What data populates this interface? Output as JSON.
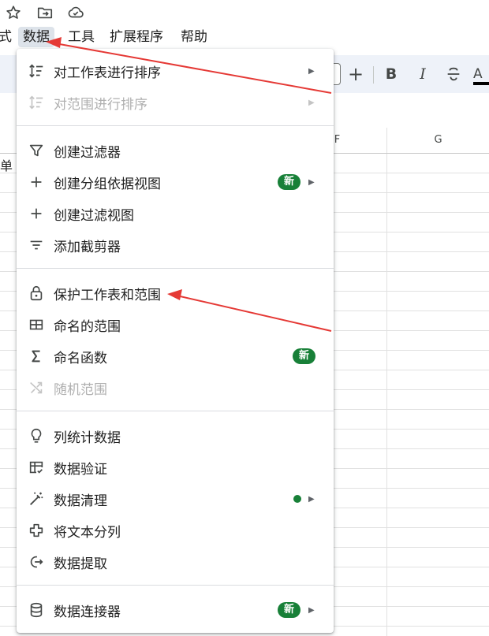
{
  "menubar": {
    "items": [
      {
        "label": "式"
      },
      {
        "label": "数据"
      },
      {
        "label": "工具"
      },
      {
        "label": "扩展程序"
      },
      {
        "label": "帮助"
      }
    ]
  },
  "toolbar": {
    "plus": "+",
    "bold": "B",
    "italic": "I",
    "text_color": "A"
  },
  "sheet": {
    "columns": [
      "F",
      "G"
    ],
    "partial_cell_text": "单"
  },
  "menu": {
    "items": [
      {
        "icon": "sort-icon",
        "label": "对工作表进行排序",
        "submenu": true
      },
      {
        "icon": "sort-range-icon",
        "label": "对范围进行排序",
        "submenu": true,
        "disabled": true
      },
      {
        "icon": "filter-icon",
        "label": "创建过滤器"
      },
      {
        "icon": "plus-icon",
        "label": "创建分组依据视图",
        "badge": "新",
        "submenu": true
      },
      {
        "icon": "plus-icon",
        "label": "创建过滤视图"
      },
      {
        "icon": "slicer-icon",
        "label": "添加截剪器"
      },
      {
        "icon": "lock-icon",
        "label": "保护工作表和范围"
      },
      {
        "icon": "table-icon",
        "label": "命名的范围"
      },
      {
        "icon": "sigma-icon",
        "label": "命名函数",
        "badge": "新"
      },
      {
        "icon": "shuffle-icon",
        "label": "随机范围",
        "disabled": true
      },
      {
        "icon": "lightbulb-icon",
        "label": "列统计数据"
      },
      {
        "icon": "validation-icon",
        "label": "数据验证"
      },
      {
        "icon": "magic-wand-icon",
        "label": "数据清理",
        "submenu": true
      },
      {
        "icon": "split-icon",
        "label": "将文本分列"
      },
      {
        "icon": "extract-icon",
        "label": "数据提取"
      },
      {
        "icon": "database-icon",
        "label": "数据连接器",
        "badge": "新",
        "submenu": true
      }
    ]
  },
  "colors": {
    "accent_green": "#188038",
    "annotation_red": "#e53935",
    "menu_active_bg": "#dde3ea"
  }
}
